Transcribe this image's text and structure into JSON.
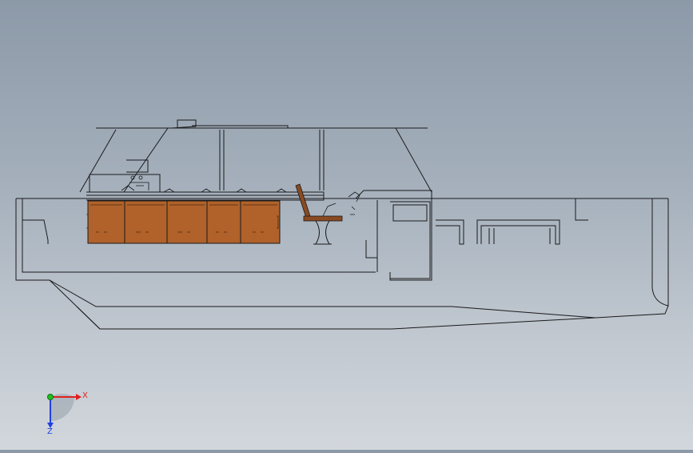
{
  "triad": {
    "x_label": "X",
    "y_label": "Y",
    "z_label": "Z",
    "x_color": "#e02020",
    "y_color": "#20c020",
    "z_color": "#2040e0"
  },
  "colors": {
    "background_top": "#8c99a8",
    "background_bottom": "#d2d7dc",
    "linework": "#1a1a1a",
    "cabinet_fill": "#b0622a",
    "seat_fill": "#8a4a22"
  },
  "cabinets": [
    {
      "index": 1
    },
    {
      "index": 2
    },
    {
      "index": 3
    },
    {
      "index": 4
    },
    {
      "index": 5
    }
  ]
}
